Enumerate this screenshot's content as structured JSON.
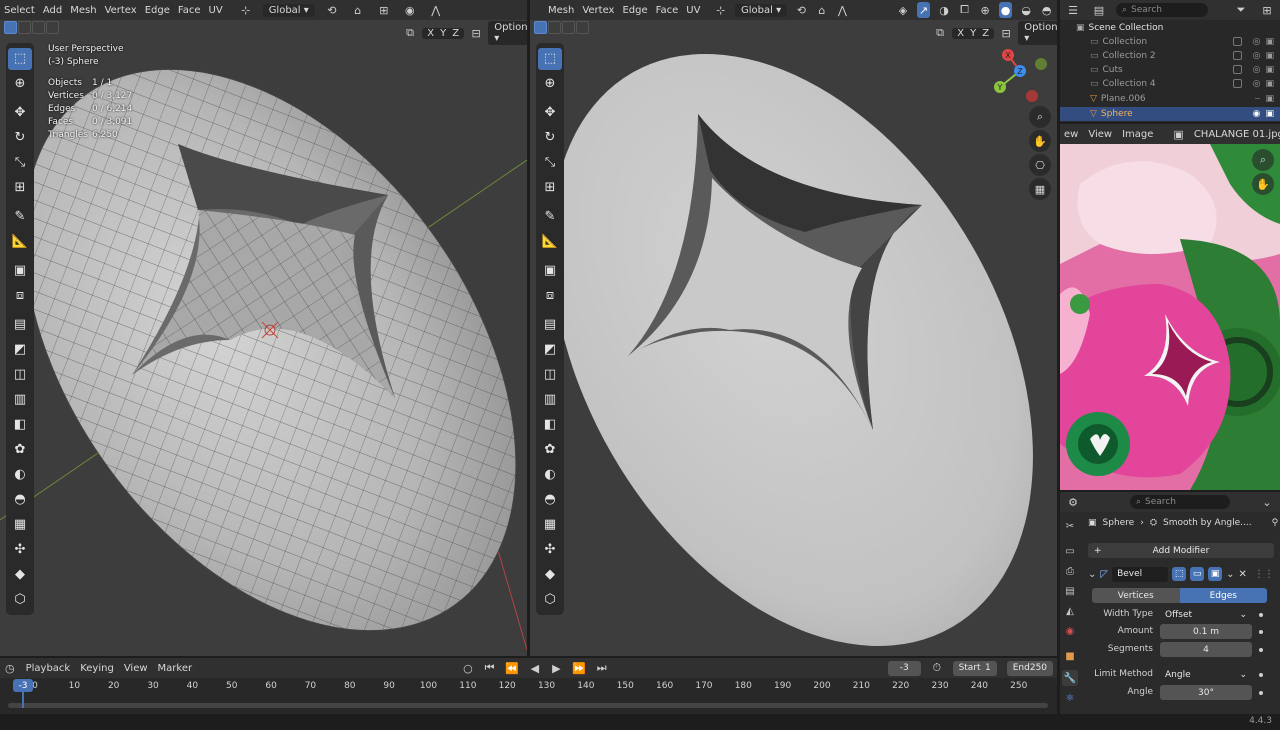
{
  "left_viewport": {
    "menu": [
      "Select",
      "Add",
      "Mesh",
      "Vertex",
      "Edge",
      "Face",
      "UV"
    ],
    "transform_orientation": "Global",
    "axes": [
      "X",
      "Y",
      "Z"
    ],
    "options_label": "Options",
    "view_name": "User Perspective",
    "object_label": "(-3) Sphere",
    "stats": [
      {
        "label": "Objects",
        "value": "1 / 1"
      },
      {
        "label": "Vertices",
        "value": "0 / 3,127"
      },
      {
        "label": "Edges",
        "value": "0 / 6,214"
      },
      {
        "label": "Faces",
        "value": "0 / 3,091"
      },
      {
        "label": "Triangles",
        "value": "6,250"
      }
    ]
  },
  "right_viewport": {
    "menu": [
      "Mesh",
      "Vertex",
      "Edge",
      "Face",
      "UV"
    ],
    "transform_orientation": "Global",
    "axes": [
      "X",
      "Y",
      "Z"
    ],
    "options_label": "Options"
  },
  "outliner": {
    "search_placeholder": "Search",
    "root": "Scene Collection",
    "items": [
      "Collection",
      "Collection 2",
      "Cuts",
      "Collection 4",
      "Plane.006",
      "Sphere"
    ]
  },
  "image_editor": {
    "menu": [
      "View",
      "Image"
    ],
    "header_cut": "ew",
    "image_name": "CHALANGE 01.jpg"
  },
  "properties": {
    "search_placeholder": "Search",
    "breadcrumb_object": "Sphere",
    "breadcrumb_modifier": "Smooth by Angle....",
    "add_modifier_label": "Add Modifier",
    "modifier_name": "Bevel",
    "affect_tabs": [
      "Vertices",
      "Edges"
    ],
    "width_type_label": "Width Type",
    "width_type_value": "Offset",
    "amount_label": "Amount",
    "amount_value": "0.1 m",
    "segments_label": "Segments",
    "segments_value": "4",
    "limit_method_label": "Limit Method",
    "limit_method_value": "Angle",
    "angle_label": "Angle",
    "angle_value": "30°"
  },
  "timeline": {
    "menu": [
      "Playback",
      "Keying",
      "View",
      "Marker"
    ],
    "current_frame": "-3",
    "start_label": "Start",
    "start_value": "1",
    "end_label": "End",
    "end_value": "250",
    "playhead_label": "-3",
    "ticks": [
      "0",
      "10",
      "20",
      "30",
      "40",
      "50",
      "60",
      "70",
      "80",
      "90",
      "100",
      "110",
      "120",
      "130",
      "140",
      "150",
      "160",
      "170",
      "180",
      "190",
      "200",
      "210",
      "220",
      "230",
      "240",
      "250"
    ]
  },
  "version": "4.4.3",
  "colors": {
    "accent_blue": "#4772b3",
    "viewport_bg": "#3d3d3d",
    "header_bg": "#303030",
    "gizmo_x": "#e04545",
    "gizmo_y": "#8cc63f",
    "gizmo_z": "#3d8ef2"
  }
}
